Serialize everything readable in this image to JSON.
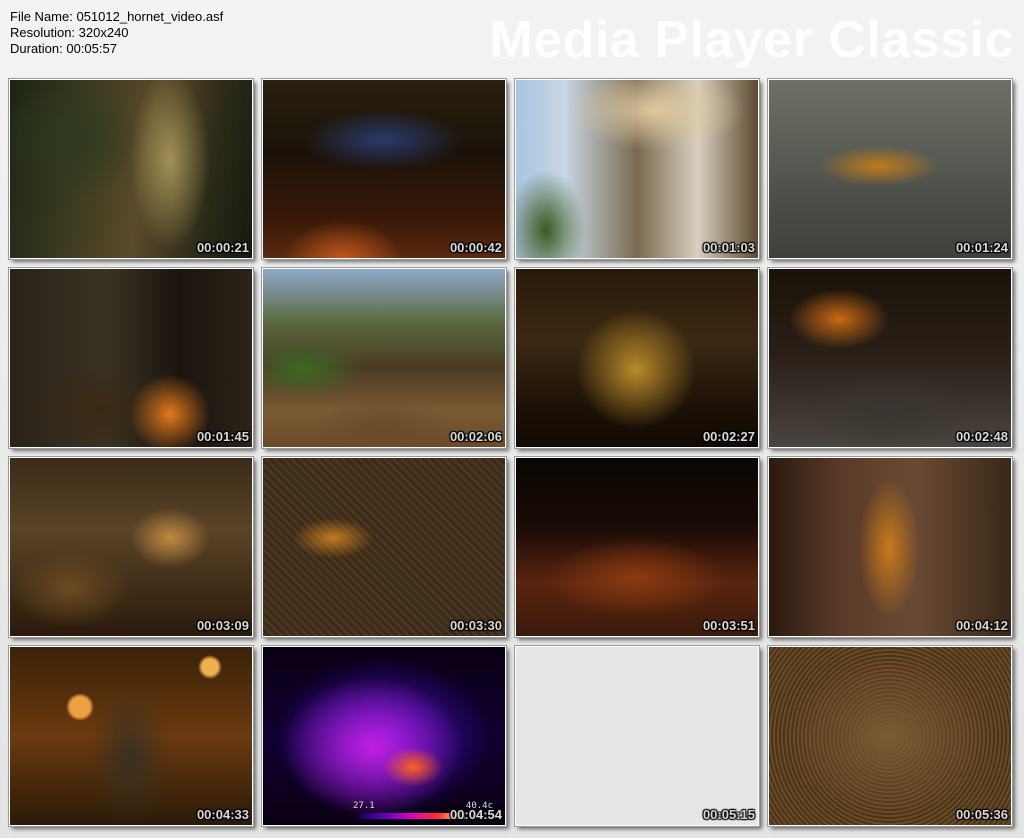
{
  "info": {
    "file_name": "File Name: 051012_hornet_video.asf",
    "resolution": "Resolution: 320x240",
    "duration": "Duration: 00:05:57"
  },
  "brand": "Media Player Classic",
  "thumbnails": [
    {
      "time": "00:00:21"
    },
    {
      "time": "00:00:42"
    },
    {
      "time": "00:01:03"
    },
    {
      "time": "00:01:24"
    },
    {
      "time": "00:01:45"
    },
    {
      "time": "00:02:06"
    },
    {
      "time": "00:02:27"
    },
    {
      "time": "00:02:48"
    },
    {
      "time": "00:03:09"
    },
    {
      "time": "00:03:30"
    },
    {
      "time": "00:03:51"
    },
    {
      "time": "00:04:12"
    },
    {
      "time": "00:04:33"
    },
    {
      "time": "00:04:54",
      "hud_left": "27.1",
      "hud_right": "40.4c"
    },
    {
      "time": "00:05:15"
    },
    {
      "time": "00:05:36"
    }
  ]
}
